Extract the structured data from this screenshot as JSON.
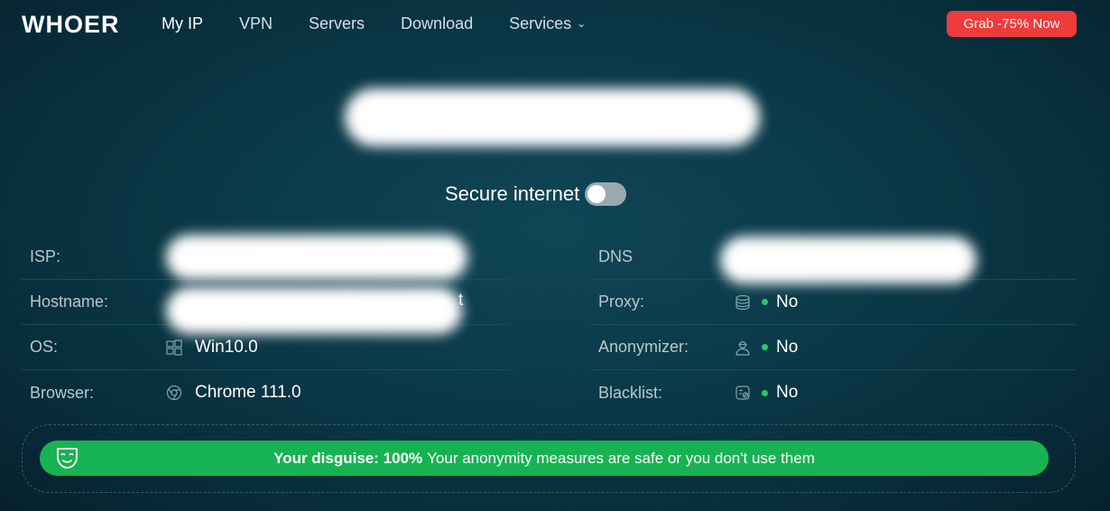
{
  "header": {
    "logo": "WHOER",
    "nav": [
      {
        "label": "My IP",
        "active": true
      },
      {
        "label": "VPN"
      },
      {
        "label": "Servers"
      },
      {
        "label": "Download"
      },
      {
        "label": "Services",
        "dropdown": true
      }
    ],
    "promo_label": "Grab -75% Now",
    "promo_color": "#ee3b3b"
  },
  "secure": {
    "label": "Secure internet",
    "toggle_on": false
  },
  "info_left": [
    {
      "label": "ISP:",
      "value": "",
      "redacted": true
    },
    {
      "label": "Hostname:",
      "value": "t",
      "redacted": true
    },
    {
      "label": "OS:",
      "value": "Win10.0",
      "icon": "windows-icon"
    },
    {
      "label": "Browser:",
      "value": "Chrome 111.0",
      "icon": "chrome-icon"
    }
  ],
  "info_right": [
    {
      "label": "DNS",
      "value": "",
      "redacted": true
    },
    {
      "label": "Proxy:",
      "value": "No",
      "icon": "database-icon",
      "status_color": "#26c86a"
    },
    {
      "label": "Anonymizer:",
      "value": "No",
      "icon": "user-agent-icon",
      "status_color": "#26c86a"
    },
    {
      "label": "Blacklist:",
      "value": "No",
      "icon": "blacklist-icon",
      "status_color": "#26c86a"
    }
  ],
  "disguise": {
    "prefix": "Your disguise: 100%",
    "message": "Your anonymity measures are safe or you don't use them",
    "icon": "mask-icon",
    "color": "#17b352"
  }
}
